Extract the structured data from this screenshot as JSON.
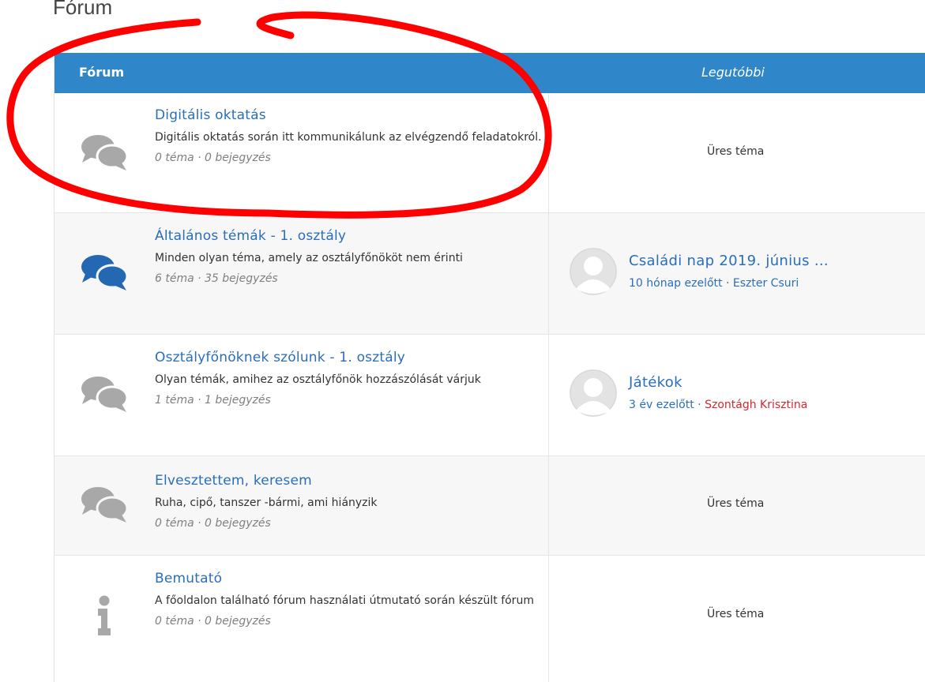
{
  "page": {
    "title": "Fórum"
  },
  "table": {
    "header": {
      "forum": "Fórum",
      "latest": "Legutóbbi"
    },
    "rows": [
      {
        "icon": "chat-bubbles-icon",
        "title": "Digitális oktatás",
        "description": "Digitális oktatás során itt kommunikálunk az elvégzendő feladatokról.",
        "stats": "0 téma · 0 bejegyzés",
        "latest": {
          "empty": "Üres téma"
        }
      },
      {
        "icon": "chat-bubbles-icon",
        "title": "Általános témák - 1. osztály",
        "description": "Minden olyan téma, amely az osztályfőnököt nem érinti",
        "stats": "6 téma · 35 bejegyzés",
        "latest": {
          "title": "Családi nap 2019. június ...",
          "time": "10 hónap ezelőtt",
          "separator": "·",
          "author": "Eszter Csuri"
        }
      },
      {
        "icon": "chat-bubbles-icon",
        "title": "Osztályfőnöknek szólunk - 1. osztály",
        "description": "Olyan témák, amihez az osztályfőnök hozzászólását várjuk",
        "stats": "1 téma · 1 bejegyzés",
        "latest": {
          "title": "Játékok",
          "time": "3 év ezelőtt",
          "separator": "·",
          "author": "Szontágh Krisztina"
        }
      },
      {
        "icon": "chat-bubbles-icon",
        "title": "Elvesztettem, keresem",
        "description": "Ruha, cipő, tanszer -bármi, ami hiányzik",
        "stats": "0 téma · 0 bejegyzés",
        "latest": {
          "empty": "Üres téma"
        }
      },
      {
        "icon": "info-icon",
        "title": "Bemutató",
        "description": "A főoldalon található fórum használati útmutató során készült fórum",
        "stats": "0 téma · 0 bejegyzés",
        "latest": {
          "empty": "Üres téma"
        }
      }
    ]
  },
  "colors": {
    "header_bg": "#2f86c8",
    "link": "#2a6ebb",
    "icon_grey": "#a8a8a8",
    "icon_blue": "#2468b4",
    "author_red": "#d9262c",
    "annotation_red": "#ff0000"
  }
}
